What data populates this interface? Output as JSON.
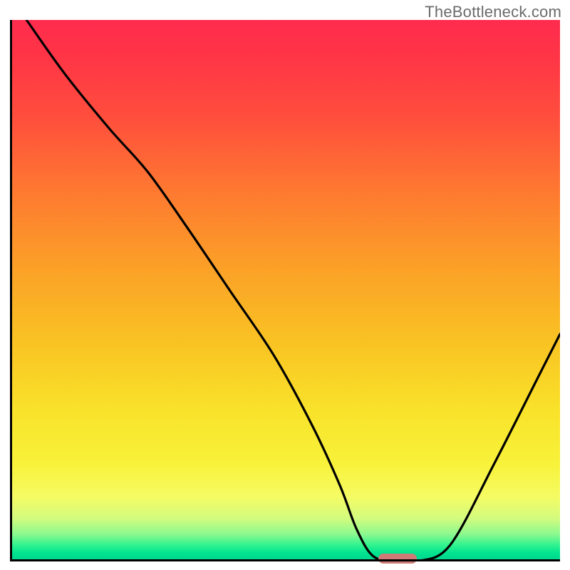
{
  "watermark": "TheBottleneck.com",
  "colors": {
    "gradient_top": "#ff2c4e",
    "gradient_bottom": "#00d38f",
    "curve": "#000000",
    "marker": "#cf7a77",
    "axis": "#000000"
  },
  "chart_data": {
    "type": "line",
    "title": "",
    "xlabel": "",
    "ylabel": "",
    "xlim": [
      0,
      100
    ],
    "ylim": [
      0,
      100
    ],
    "legend": false,
    "grid": false,
    "axes": {
      "left": true,
      "bottom": true,
      "right": false,
      "top": false
    },
    "series": [
      {
        "name": "bottleneck-curve",
        "x": [
          3,
          10,
          18,
          25,
          32,
          40,
          48,
          55,
          60,
          63,
          66,
          70,
          74,
          80,
          88,
          96,
          100
        ],
        "y": [
          100,
          90,
          80,
          72,
          62,
          50,
          38,
          25,
          14,
          6,
          1,
          0,
          0,
          3,
          18,
          34,
          42
        ]
      }
    ],
    "annotations": [
      {
        "name": "optimum-marker",
        "shape": "pill",
        "x_range": [
          67,
          74
        ],
        "y": 0.5,
        "color": "#cf7a77"
      }
    ]
  }
}
